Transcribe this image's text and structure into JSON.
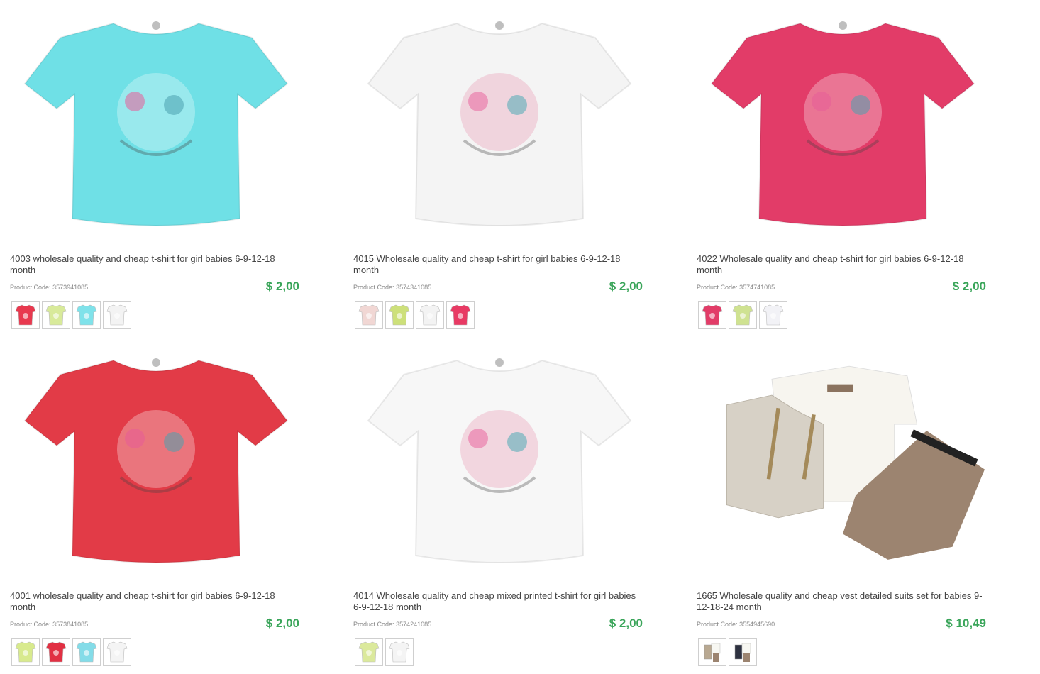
{
  "products": [
    {
      "title": "4003 wholesale quality and cheap t-shirt for girl babies 6-9-12-18 month",
      "code_label": "Product Code:",
      "code": "3573941085",
      "price": "$ 2,00",
      "main_color": "#6fe0e6",
      "thumb_colors": [
        "#e8394f",
        "#d8ea9a",
        "#7fe2ea",
        "#f3f3f3"
      ]
    },
    {
      "title": "4015 Wholesale quality and cheap t-shirt for girl babies 6-9-12-18 month",
      "code_label": "Product Code:",
      "code": "3574341085",
      "price": "$ 2,00",
      "main_color": "#f4f4f4",
      "thumb_colors": [
        "#f1d7d4",
        "#cde07a",
        "#f3f3f3",
        "#e83a64"
      ]
    },
    {
      "title": "4022 Wholesale quality and cheap t-shirt for girl babies 6-9-12-18 month",
      "code_label": "Product Code:",
      "code": "3574741085",
      "price": "$ 2,00",
      "main_color": "#e23c68",
      "thumb_colors": [
        "#e23c68",
        "#cfe291",
        "#f2f2f6"
      ]
    },
    {
      "title": "4001 wholesale quality and cheap t-shirt for girl babies 6-9-12-18 month",
      "code_label": "Product Code:",
      "code": "3573841085",
      "price": "$ 2,00",
      "main_color": "#e23b47",
      "thumb_colors": [
        "#d8ea8e",
        "#e13043",
        "#84dce8",
        "#f4f4f4"
      ]
    },
    {
      "title": "4014 Wholesale quality and cheap mixed printed t-shirt for girl babies 6-9-12-18 month",
      "code_label": "Product Code:",
      "code": "3574241085",
      "price": "$ 2,00",
      "main_color": "#f7f7f7",
      "thumb_colors": [
        "#dbe99c",
        "#f4f4f4"
      ]
    },
    {
      "title": "1665 Wholesale quality and cheap vest detailed suits set for babies 9-12-18-24 month",
      "code_label": "Product Code:",
      "code": "3554945690",
      "price": "$ 10,49",
      "main_color": "#d7d1c6",
      "thumb_colors": [
        "#b8a891",
        "#2d3140"
      ]
    }
  ]
}
